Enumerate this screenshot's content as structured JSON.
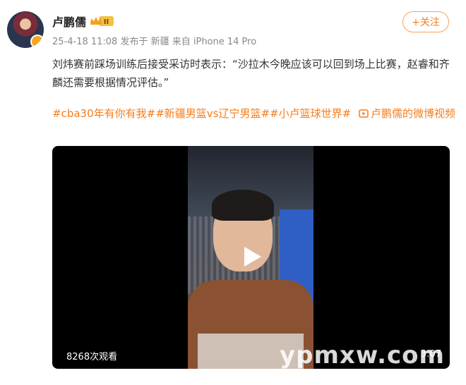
{
  "author": {
    "name": "卢鹏儒",
    "level_badge": "II",
    "meta": "25-4-18 11:08 发布于 新疆 来自 iPhone 14 Pro"
  },
  "follow": {
    "label": "+关注"
  },
  "post": {
    "text": "刘炜赛前踩场训练后接受采访时表示：“沙拉木今晚应该可以回到场上比赛，赵睿和齐麟还需要根据情况评估。”",
    "tags": [
      "#cba30年有你有我#",
      "#新疆男篮vs辽宁男篮#",
      "#小卢篮球世界#",
      "卢鹏儒的微博视频"
    ]
  },
  "video": {
    "views": "8268次观看",
    "timer": "3:07",
    "watermark": "ypmxw.com"
  },
  "colors": {
    "accent": "#f77c1a",
    "text": "#333333",
    "meta": "#888888"
  }
}
